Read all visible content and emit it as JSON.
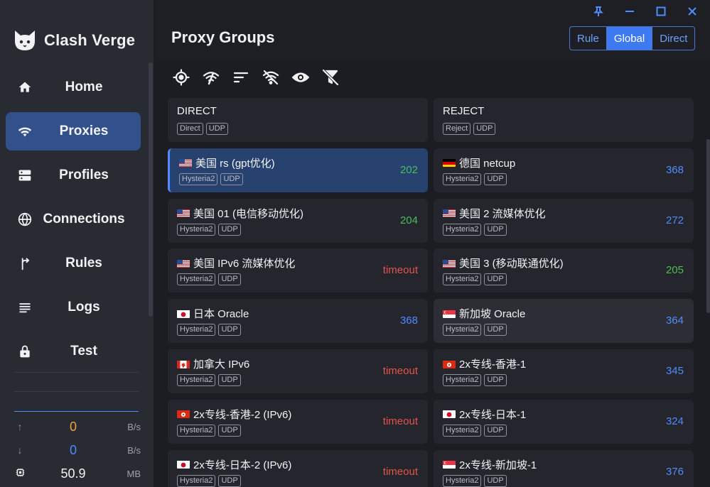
{
  "app": {
    "name": "Clash Verge",
    "page_title": "Proxy Groups"
  },
  "colors": {
    "accent": "#3d7af2",
    "active_nav": "#32508a",
    "delay_green": "#4cbb5a",
    "delay_blue": "#4f8cff",
    "delay_red": "#e5534b"
  },
  "window_controls": [
    "pin-icon",
    "minimize-icon",
    "maximize-icon",
    "close-icon"
  ],
  "sidebar": {
    "items": [
      {
        "label": "Home",
        "icon": "home-icon"
      },
      {
        "label": "Proxies",
        "icon": "wifi-icon",
        "active": true
      },
      {
        "label": "Profiles",
        "icon": "server-icon"
      },
      {
        "label": "Connections",
        "icon": "globe-icon"
      },
      {
        "label": "Rules",
        "icon": "fork-icon"
      },
      {
        "label": "Logs",
        "icon": "list-icon"
      },
      {
        "label": "Test",
        "icon": "lock-icon"
      }
    ],
    "traffic": {
      "upload": {
        "value": "0",
        "unit": "B/s",
        "icon": "arrow-up-icon"
      },
      "download": {
        "value": "0",
        "unit": "B/s",
        "icon": "arrow-down-icon"
      },
      "memory": {
        "value": "50.9",
        "unit": "MB",
        "icon": "memory-icon"
      }
    }
  },
  "mode": {
    "options": [
      "Rule",
      "Global",
      "Direct"
    ],
    "selected": "Global"
  },
  "toolbar": [
    "locate-icon",
    "delay-test-icon",
    "sort-icon",
    "filter-off-icon",
    "eye-icon",
    "filter-clear-icon"
  ],
  "proxies": [
    {
      "name": "DIRECT",
      "tags": [
        "Direct",
        "UDP"
      ],
      "delay": "",
      "flag": ""
    },
    {
      "name": "REJECT",
      "tags": [
        "Reject",
        "UDP"
      ],
      "delay": "",
      "flag": ""
    },
    {
      "name": "美国 rs (gpt优化)",
      "tags": [
        "Hysteria2",
        "UDP"
      ],
      "delay": "202",
      "flag": "us",
      "selected": true
    },
    {
      "name": "德国 netcup",
      "tags": [
        "Hysteria2",
        "UDP"
      ],
      "delay": "368",
      "flag": "de"
    },
    {
      "name": "美国 01 (电信移动优化)",
      "tags": [
        "Hysteria2",
        "UDP"
      ],
      "delay": "204",
      "flag": "us"
    },
    {
      "name": "美国 2 流媒体优化",
      "tags": [
        "Hysteria2",
        "UDP"
      ],
      "delay": "272",
      "flag": "us"
    },
    {
      "name": "美国 IPv6 流媒体优化",
      "tags": [
        "Hysteria2",
        "UDP"
      ],
      "delay": "timeout",
      "flag": "us"
    },
    {
      "name": "美国 3 (移动联通优化)",
      "tags": [
        "Hysteria2",
        "UDP"
      ],
      "delay": "205",
      "flag": "us"
    },
    {
      "name": "日本 Oracle",
      "tags": [
        "Hysteria2",
        "UDP"
      ],
      "delay": "368",
      "flag": "jp"
    },
    {
      "name": "新加坡 Oracle",
      "tags": [
        "Hysteria2",
        "UDP"
      ],
      "delay": "364",
      "flag": "sg",
      "hover": true
    },
    {
      "name": "加拿大 IPv6",
      "tags": [
        "Hysteria2",
        "UDP"
      ],
      "delay": "timeout",
      "flag": "ca"
    },
    {
      "name": "2x专线-香港-1",
      "tags": [
        "Hysteria2",
        "UDP"
      ],
      "delay": "345",
      "flag": "hk"
    },
    {
      "name": "2x专线-香港-2 (IPv6)",
      "tags": [
        "Hysteria2",
        "UDP"
      ],
      "delay": "timeout",
      "flag": "hk"
    },
    {
      "name": "2x专线-日本-1",
      "tags": [
        "Hysteria2",
        "UDP"
      ],
      "delay": "324",
      "flag": "jp"
    },
    {
      "name": "2x专线-日本-2 (IPv6)",
      "tags": [
        "Hysteria2",
        "UDP"
      ],
      "delay": "timeout",
      "flag": "jp"
    },
    {
      "name": "2x专线-新加坡-1",
      "tags": [
        "Hysteria2",
        "UDP"
      ],
      "delay": "376",
      "flag": "sg"
    }
  ]
}
